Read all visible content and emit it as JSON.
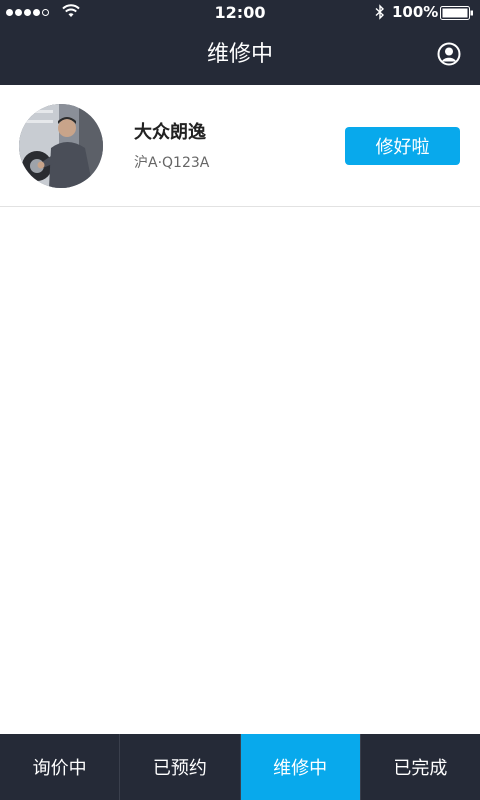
{
  "status_bar": {
    "time": "12:00",
    "battery": "100%",
    "icons": [
      "signal-dots-icon",
      "wifi-icon",
      "bluetooth-icon",
      "battery-icon"
    ]
  },
  "header": {
    "title": "维修中",
    "profile_icon": "user-circle-icon"
  },
  "order": {
    "car_model": "大众朗逸",
    "plate": "沪A·Q123A",
    "action_label": "修好啦"
  },
  "tabs": [
    {
      "label": "询价中",
      "active": false
    },
    {
      "label": "已预约",
      "active": false
    },
    {
      "label": "维修中",
      "active": true
    },
    {
      "label": "已完成",
      "active": false
    }
  ],
  "colors": {
    "header_bg": "#252a37",
    "accent": "#08a9ec",
    "divider": "#e2e2e2"
  }
}
